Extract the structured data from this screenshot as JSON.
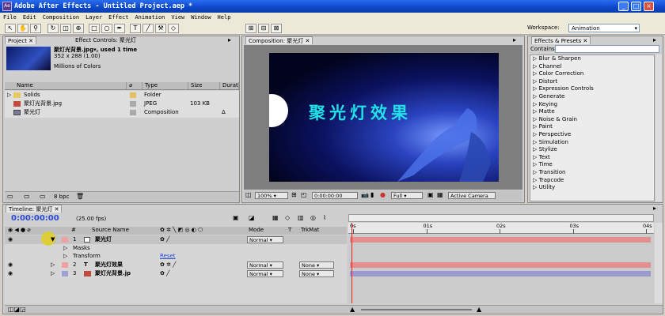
{
  "window": {
    "title": "Adobe After Effects - Untitled Project.aep *",
    "icon": "Ae"
  },
  "menu": [
    "File",
    "Edit",
    "Composition",
    "Layer",
    "Effect",
    "Animation",
    "View",
    "Window",
    "Help"
  ],
  "workspace": {
    "label": "Workspace:",
    "value": "Animation"
  },
  "project": {
    "tabs": [
      "Project",
      "Effect Controls: 聚光灯"
    ],
    "preview": {
      "name": "聚灯光背景.jpg",
      "used": "▾, used 1 time",
      "dims": "352 x 288 (1.00)",
      "colors": "Millions of Colors"
    },
    "columns": [
      "Name",
      "Type",
      "Size",
      "Durat"
    ],
    "items": [
      {
        "name": "Solids",
        "type": "Folder",
        "size": "",
        "color": "#e0c060"
      },
      {
        "name": "聚灯光背景.jpg",
        "type": "JPEG",
        "size": "103 KB",
        "color": "#aaaaaa"
      },
      {
        "name": "聚光灯",
        "type": "Composition",
        "size": "",
        "dur": "Δ",
        "color": "#aaaaaa"
      }
    ],
    "bpc": "8 bpc"
  },
  "composition": {
    "tab": "Composition: 聚光灯",
    "title_text": "聚光灯效果",
    "zoom": "100%",
    "timecode": "0:00:00:00",
    "resolution": "Full",
    "camera": "Active Camera",
    "colors": {
      "text": "#22e0e8",
      "bg": "#02041e"
    }
  },
  "effects": {
    "tab": "Effects & Presets",
    "contains_label": "Contains:",
    "items": [
      "Blur & Sharpen",
      "Channel",
      "Color Correction",
      "Distort",
      "Expression Controls",
      "Generate",
      "Keying",
      "Matte",
      "Noise & Grain",
      "Paint",
      "Perspective",
      "Simulation",
      "Stylize",
      "Text",
      "Time",
      "Transition",
      "Trapcode",
      "Utility"
    ]
  },
  "timeline": {
    "tab": "Timeline: 聚光灯",
    "timecode": "0:00:00:00",
    "fps": "(25.00 fps)",
    "col_num": "#",
    "col_source": "Source Name",
    "col_mode": "Mode",
    "col_t": "T",
    "col_trkmat": "TrkMat",
    "ruler": [
      "0s",
      "01s",
      "02s",
      "03s",
      "04s"
    ],
    "layers": [
      {
        "num": "1",
        "name": "聚光灯",
        "mode": "Normal",
        "trkmat": "",
        "color": "#f0a0a0",
        "bar": "#e48f8f"
      },
      {
        "num": "2",
        "name": "聚光灯效果",
        "mode": "Normal",
        "trkmat": "None",
        "color": "#f0a0a0",
        "bar": "#e48f8f"
      },
      {
        "num": "3",
        "name": "聚灯光背景.jp",
        "mode": "Normal",
        "trkmat": "None",
        "color": "#a0a0d8",
        "bar": "#9a9ad0"
      }
    ],
    "masks_label": "Masks",
    "transform_label": "Transform",
    "reset_label": "Reset"
  }
}
